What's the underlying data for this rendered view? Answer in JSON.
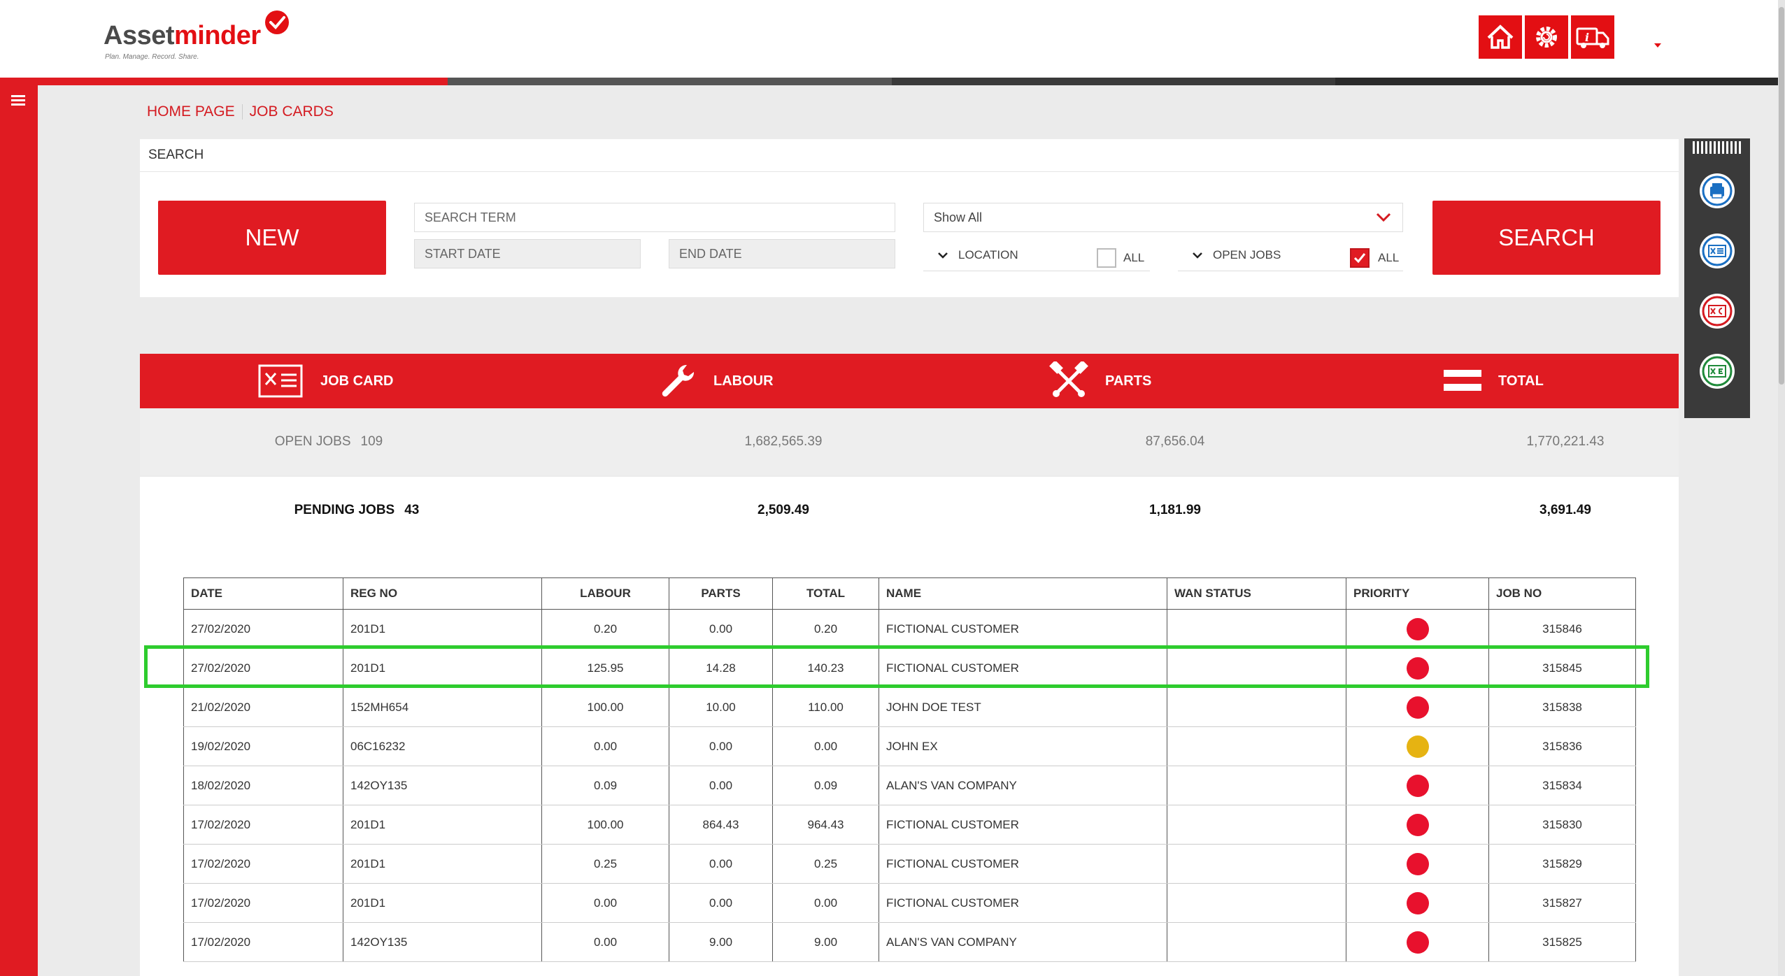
{
  "logo": {
    "name_part1": "Asset",
    "name_part2": "minder",
    "tagline": "Plan. Manage. Record. Share."
  },
  "header": {
    "icons": [
      "home-icon",
      "gear-refresh-icon",
      "truck-info-icon"
    ]
  },
  "colors": {
    "brand_red": "#e01b22",
    "priority_high": "#e8112d",
    "priority_medium": "#e6b312",
    "highlight": "#2ecc2e"
  },
  "breadcrumb": {
    "home": "HOME PAGE",
    "current": "JOB CARDS"
  },
  "search": {
    "title": "SEARCH",
    "new_label": "NEW",
    "search_label": "SEARCH",
    "term_placeholder": "SEARCH TERM",
    "start_placeholder": "START DATE",
    "end_placeholder": "END DATE",
    "filter_value": "Show All",
    "location_label": "LOCATION",
    "location_all_label": "ALL",
    "open_jobs_label": "OPEN JOBS",
    "open_jobs_all_label": "ALL"
  },
  "summary": {
    "headers": {
      "job_card": "JOB CARD",
      "labour": "LABOUR",
      "parts": "PARTS",
      "total": "TOTAL"
    },
    "open": {
      "label": "OPEN JOBS",
      "count": "109",
      "labour": "1,682,565.39",
      "parts": "87,656.04",
      "total": "1,770,221.43"
    },
    "pending": {
      "label": "PENDING JOBS",
      "count": "43",
      "labour": "2,509.49",
      "parts": "1,181.99",
      "total": "3,691.49"
    }
  },
  "table": {
    "columns": {
      "date": "DATE",
      "reg": "REG NO",
      "labour": "LABOUR",
      "parts": "PARTS",
      "total": "TOTAL",
      "name": "NAME",
      "wan": "WAN STATUS",
      "priority": "PRIORITY",
      "job": "JOB NO"
    },
    "rows": [
      {
        "date": "27/02/2020",
        "reg": "201D1",
        "labour": "0.20",
        "parts": "0.00",
        "total": "0.20",
        "name": "FICTIONAL CUSTOMER",
        "wan": "",
        "priority": "high",
        "job": "315846"
      },
      {
        "date": "27/02/2020",
        "reg": "201D1",
        "labour": "125.95",
        "parts": "14.28",
        "total": "140.23",
        "name": "FICTIONAL CUSTOMER",
        "wan": "",
        "priority": "high",
        "job": "315845"
      },
      {
        "date": "21/02/2020",
        "reg": "152MH654",
        "labour": "100.00",
        "parts": "10.00",
        "total": "110.00",
        "name": "JOHN DOE TEST",
        "wan": "",
        "priority": "high",
        "job": "315838"
      },
      {
        "date": "19/02/2020",
        "reg": "06C16232",
        "labour": "0.00",
        "parts": "0.00",
        "total": "0.00",
        "name": "JOHN EX",
        "wan": "",
        "priority": "medium",
        "job": "315836"
      },
      {
        "date": "18/02/2020",
        "reg": "142OY135",
        "labour": "0.09",
        "parts": "0.00",
        "total": "0.09",
        "name": "ALAN'S VAN COMPANY",
        "wan": "",
        "priority": "high",
        "job": "315834"
      },
      {
        "date": "17/02/2020",
        "reg": "201D1",
        "labour": "100.00",
        "parts": "864.43",
        "total": "964.43",
        "name": "FICTIONAL CUSTOMER",
        "wan": "",
        "priority": "high",
        "job": "315830"
      },
      {
        "date": "17/02/2020",
        "reg": "201D1",
        "labour": "0.25",
        "parts": "0.00",
        "total": "0.25",
        "name": "FICTIONAL CUSTOMER",
        "wan": "",
        "priority": "high",
        "job": "315829"
      },
      {
        "date": "17/02/2020",
        "reg": "201D1",
        "labour": "0.00",
        "parts": "0.00",
        "total": "0.00",
        "name": "FICTIONAL CUSTOMER",
        "wan": "",
        "priority": "high",
        "job": "315827"
      },
      {
        "date": "17/02/2020",
        "reg": "142OY135",
        "labour": "0.00",
        "parts": "9.00",
        "total": "9.00",
        "name": "ALAN'S VAN COMPANY",
        "wan": "",
        "priority": "high",
        "job": "315825"
      }
    ]
  },
  "right_tools": [
    "print-icon",
    "job-card-export-icon",
    "pdf-export-icon",
    "excel-export-icon"
  ]
}
